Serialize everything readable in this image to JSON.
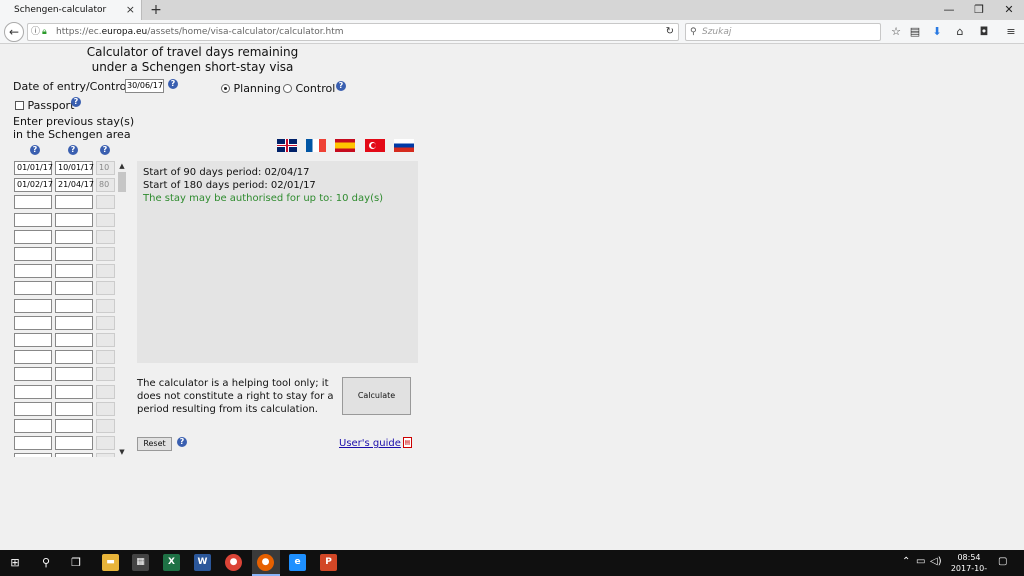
{
  "browser": {
    "tab_title": "Schengen-calculator",
    "tab_close": "×",
    "new_tab": "+",
    "url_prefix": "https://ec.",
    "url_domain": "europa.eu",
    "url_path": "/assets/home/visa-calculator/calculator.htm",
    "search_placeholder": "Szukaj",
    "window_controls": [
      "—",
      "❐",
      "✕"
    ]
  },
  "form": {
    "title_line1": "Calculator of travel days remaining",
    "title_line2": "under a Schengen short-stay visa",
    "date_label": "Date of entry/Control:",
    "date_value": "30/06/17",
    "mode_planning": "Planning",
    "mode_control": "Control",
    "selected_mode": "planning",
    "passport_label": "Passport",
    "prev_stays_label_1": "Enter previous stay(s)",
    "prev_stays_label_2": "in the Schengen area",
    "help_glyph": "?"
  },
  "stays": [
    {
      "entry": "01/01/17",
      "exit": "10/01/17",
      "days": "10"
    },
    {
      "entry": "01/02/17",
      "exit": "21/04/17",
      "days": "80"
    }
  ],
  "empty_stay_rows": 16,
  "languages": [
    {
      "code": "en",
      "colors": [
        "#012169",
        "#ffffff",
        "#c8102e"
      ]
    },
    {
      "code": "fr",
      "colors": [
        "#0055a4",
        "#ffffff",
        "#ef4135"
      ]
    },
    {
      "code": "es",
      "colors": [
        "#c60b1e",
        "#ffc400",
        "#c60b1e"
      ]
    },
    {
      "code": "tr",
      "colors": [
        "#e30a17",
        "#ffffff"
      ]
    },
    {
      "code": "ru",
      "colors": [
        "#ffffff",
        "#0039a6",
        "#d52b1e"
      ]
    }
  ],
  "result": {
    "line1": "Start of 90 days period: 02/04/17",
    "line2": "Start of 180 days period: 02/01/17",
    "line3": "The stay may be authorised for up to: 10 day(s)"
  },
  "footer": {
    "note": "The calculator is a helping tool only; it does not constitute a right to stay for a period resulting from its calculation.",
    "calculate_label": "Calculate",
    "reset_label": "Reset",
    "guide_label": "User's guide"
  },
  "taskbar": {
    "time": "08:54",
    "date": "2017-10-02"
  }
}
